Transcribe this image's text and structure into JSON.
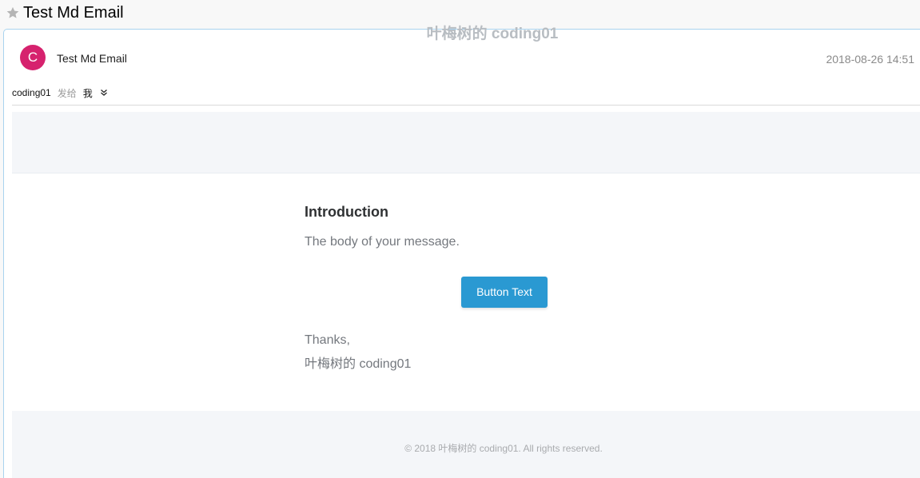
{
  "window": {
    "title": "Test Md Email",
    "star_icon": "star-icon"
  },
  "message": {
    "avatar_letter": "C",
    "avatar_color": "#d6226e",
    "sender": "Test Md Email",
    "date": "2018-08-26 14:51",
    "from": "coding01",
    "sent_to_label": "发给",
    "to": "我",
    "expand_icon": "double-chevron-down-icon"
  },
  "email": {
    "brand": "叶梅树的 coding01",
    "heading": "Introduction",
    "body": "The body of your message.",
    "button_label": "Button Text",
    "button_color": "#2a99d2",
    "closing": "Thanks,",
    "signature": "叶梅树的 coding01",
    "footer": "© 2018 叶梅树的 coding01. All rights reserved."
  }
}
